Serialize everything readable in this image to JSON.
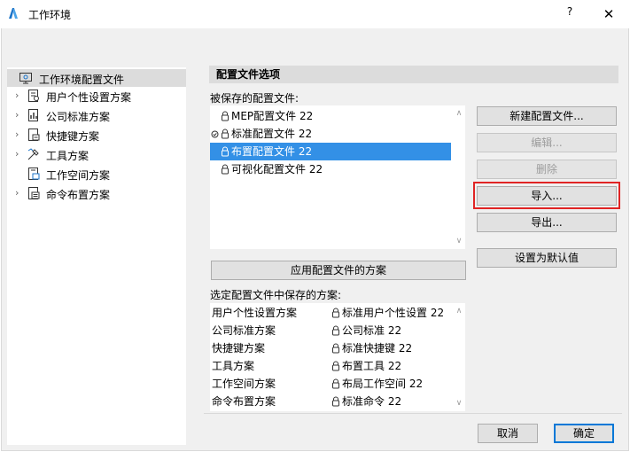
{
  "window": {
    "title": "工作环境",
    "help_label": "?",
    "close_label": "✕"
  },
  "tree": {
    "items": [
      {
        "label": "工作环境配置文件",
        "icon": "profile-icon",
        "selected": true,
        "expandable": false
      },
      {
        "label": "用户个性设置方案",
        "icon": "user-settings-icon",
        "selected": false,
        "expandable": true
      },
      {
        "label": "公司标准方案",
        "icon": "company-standards-icon",
        "selected": false,
        "expandable": true
      },
      {
        "label": "快捷键方案",
        "icon": "shortcut-icon",
        "selected": false,
        "expandable": true
      },
      {
        "label": "工具方案",
        "icon": "tools-icon",
        "selected": false,
        "expandable": true
      },
      {
        "label": "工作空间方案",
        "icon": "workspace-icon",
        "selected": false,
        "expandable": false
      },
      {
        "label": "命令布置方案",
        "icon": "command-layout-icon",
        "selected": false,
        "expandable": true
      }
    ]
  },
  "section": {
    "header": "配置文件选项",
    "saved_label": "被保存的配置文件:",
    "schemes_label": "选定配置文件中保存的方案:"
  },
  "profiles": [
    {
      "label": "MEP配置文件 22",
      "check": false,
      "selected": false
    },
    {
      "label": "标准配置文件 22",
      "check": true,
      "selected": false
    },
    {
      "label": "布置配置文件 22",
      "check": false,
      "selected": true
    },
    {
      "label": "可视化配置文件 22",
      "check": false,
      "selected": false
    }
  ],
  "buttons": {
    "new_profile": "新建配置文件...",
    "edit": "编辑...",
    "delete": "删除",
    "import": "导入...",
    "export": "导出...",
    "set_default": "设置为默认值",
    "apply_schemes": "应用配置文件的方案",
    "cancel": "取消",
    "ok": "确定"
  },
  "schemes": [
    {
      "type": "用户个性设置方案",
      "value": "标准用户个性设置 22"
    },
    {
      "type": "公司标准方案",
      "value": "公司标准 22"
    },
    {
      "type": "快捷键方案",
      "value": "标准快捷键 22"
    },
    {
      "type": "工具方案",
      "value": "布置工具 22"
    },
    {
      "type": "工作空间方案",
      "value": "布局工作空间 22"
    },
    {
      "type": "命令布置方案",
      "value": "标准命令 22"
    }
  ],
  "colors": {
    "selection": "#3390e6",
    "highlight_border": "#e02424",
    "primary_border": "#0078d7"
  }
}
